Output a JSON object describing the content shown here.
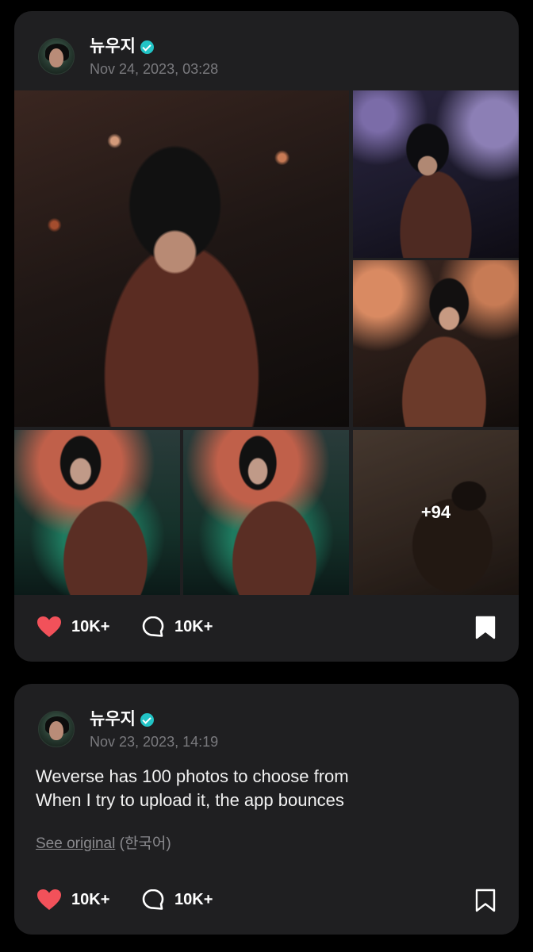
{
  "posts": [
    {
      "author": "뉴우지",
      "verified": true,
      "timestamp": "Nov 24, 2023, 03:28",
      "photos_more_label": "+94",
      "likes": "10K+",
      "comments": "10K+",
      "bookmarked": true
    },
    {
      "author": "뉴우지",
      "verified": true,
      "timestamp": "Nov 23, 2023, 14:19",
      "text_lines": [
        "Weverse has 100 photos to choose from",
        "When I try to upload it, the app bounces"
      ],
      "see_original_link": "See original",
      "see_original_lang": "(한국어)",
      "likes": "10K+",
      "comments": "10K+",
      "bookmarked": false
    }
  ],
  "colors": {
    "background": "#000000",
    "card": "#1f1f21",
    "like_heart": "#f2515a",
    "verified_badge": "#22c4c6",
    "muted_text": "#7a7a7e"
  },
  "icons": {
    "like": "heart-icon",
    "comment": "comment-bubble-icon",
    "bookmark": "bookmark-icon",
    "verified": "verified-badge-icon"
  }
}
